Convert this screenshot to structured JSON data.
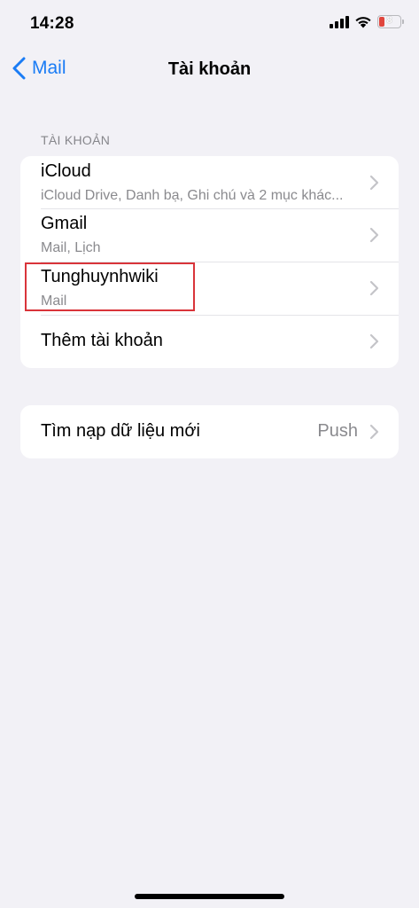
{
  "status_bar": {
    "time": "14:28",
    "battery_level": "8",
    "battery_color": "#e0453d",
    "icons": [
      "cellular-signal-icon",
      "wifi-icon",
      "battery-icon"
    ]
  },
  "nav": {
    "back_label": "Mail",
    "title": "Tài khoản",
    "accent_color": "#1a7cf5"
  },
  "accounts_section": {
    "header": "TÀI KHOẢN",
    "rows": [
      {
        "title": "iCloud",
        "subtitle": "iCloud Drive, Danh bạ, Ghi chú và 2 mục khác..."
      },
      {
        "title": "Gmail",
        "subtitle": "Mail, Lịch"
      },
      {
        "title": "Tunghuynhwiki",
        "subtitle": "Mail"
      },
      {
        "title": "Thêm tài khoản"
      }
    ]
  },
  "fetch_section": {
    "title": "Tìm nạp dữ liệu mới",
    "value": "Push"
  },
  "annotation": {
    "highlight_color": "#d9343a"
  }
}
